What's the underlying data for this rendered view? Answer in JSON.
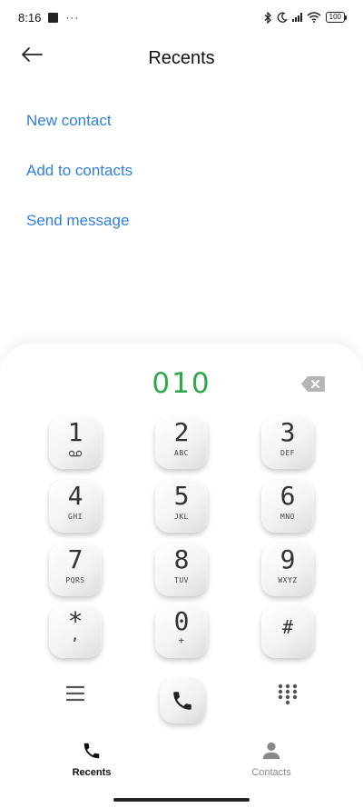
{
  "status_bar": {
    "time": "8:16",
    "dots": "···",
    "battery": "100"
  },
  "header": {
    "title": "Recents"
  },
  "actions": [
    {
      "label": "New contact"
    },
    {
      "label": "Add to contacts"
    },
    {
      "label": "Send message"
    }
  ],
  "dialer": {
    "number": "010",
    "keys": [
      {
        "digit": "1",
        "letters": ""
      },
      {
        "digit": "2",
        "letters": "ABC"
      },
      {
        "digit": "3",
        "letters": "DEF"
      },
      {
        "digit": "4",
        "letters": "GHI"
      },
      {
        "digit": "5",
        "letters": "JKL"
      },
      {
        "digit": "6",
        "letters": "MNO"
      },
      {
        "digit": "7",
        "letters": "PQRS"
      },
      {
        "digit": "8",
        "letters": "TUV"
      },
      {
        "digit": "9",
        "letters": "WXYZ"
      },
      {
        "digit": "*",
        "letters": ","
      },
      {
        "digit": "0",
        "letters": "+"
      },
      {
        "digit": "#",
        "letters": ""
      }
    ]
  },
  "bottom_nav": {
    "recents": "Recents",
    "contacts": "Contacts"
  },
  "colors": {
    "accent": "#2f80d8",
    "number": "#2ea84f"
  },
  "icons": [
    "back-arrow-icon",
    "voicemail-icon",
    "backspace-icon",
    "menu-icon",
    "call-icon",
    "keypad-icon",
    "phone-icon",
    "contact-person-icon",
    "bluetooth-icon",
    "moon-icon",
    "signal-icon",
    "wifi-icon",
    "battery-icon"
  ]
}
